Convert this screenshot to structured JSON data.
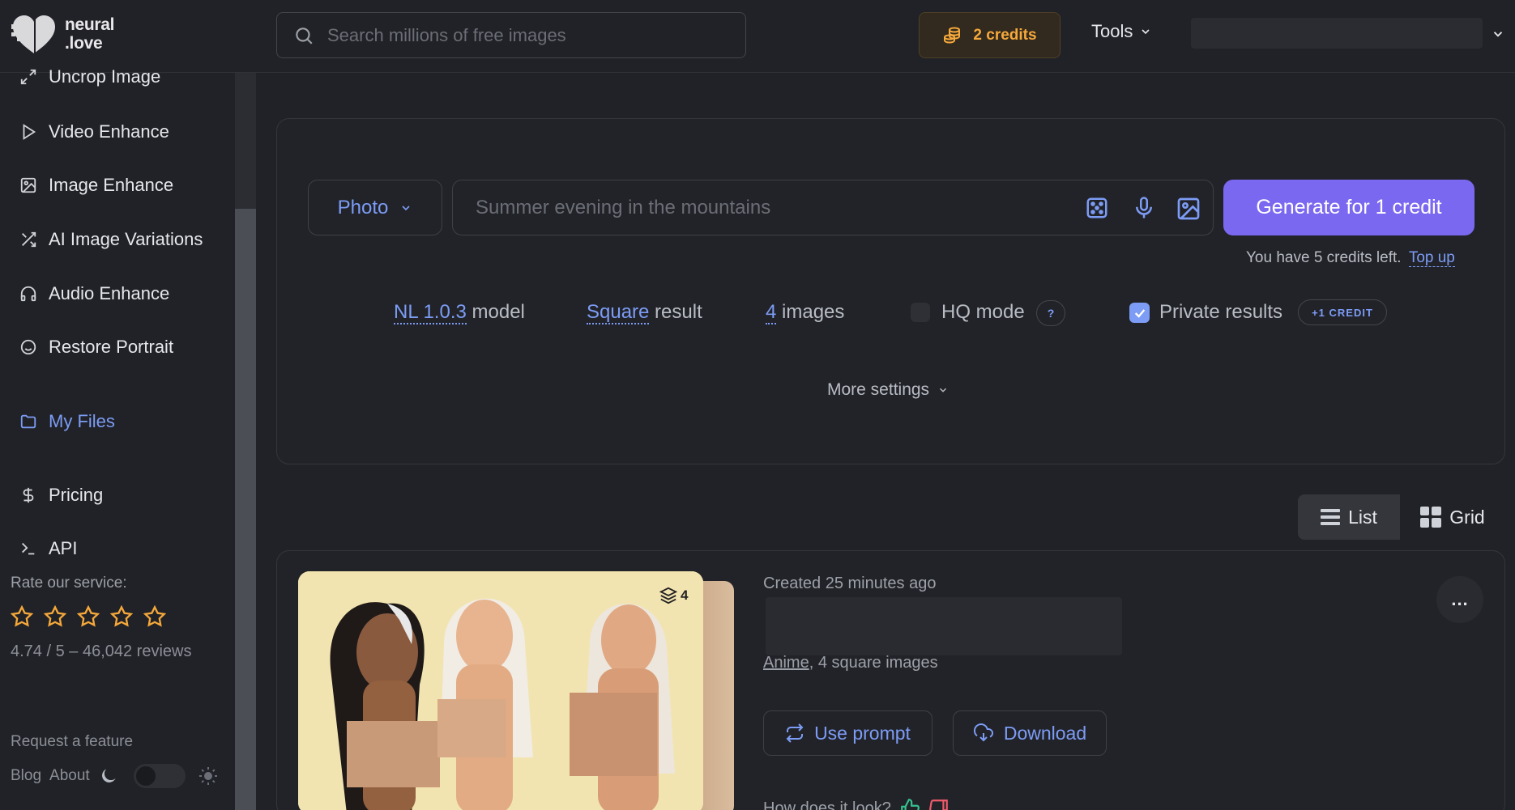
{
  "header": {
    "logo_line1": "neural",
    "logo_line2": ".love",
    "search_placeholder": "Search millions of free images",
    "credits_label": "2 credits",
    "tools_label": "Tools"
  },
  "sidebar": {
    "items": [
      {
        "label": "Uncrop Image",
        "icon": "expand-icon"
      },
      {
        "label": "Video Enhance",
        "icon": "play-icon"
      },
      {
        "label": "Image Enhance",
        "icon": "image-icon"
      },
      {
        "label": "AI Image Variations",
        "icon": "shuffle-icon"
      },
      {
        "label": "Audio Enhance",
        "icon": "headphones-icon"
      },
      {
        "label": "Restore Portrait",
        "icon": "smile-icon"
      }
    ],
    "my_files": "My Files",
    "pricing": "Pricing",
    "api": "API",
    "rate_label": "Rate our service:",
    "rating_text": "4.74 / 5 – 46,042 reviews",
    "request_feature": "Request a feature",
    "blog": "Blog",
    "about": "About"
  },
  "generator": {
    "type_label": "Photo",
    "prompt_placeholder": "Summer evening in the mountains",
    "generate_label": "Generate for 1 credit",
    "credits_left_text": "You have 5 credits left.",
    "top_up": "Top up",
    "model_value": "NL 1.0.3",
    "model_suffix": " model",
    "shape_value": "Square",
    "shape_suffix": " result",
    "count_value": "4",
    "count_suffix": " images",
    "hq_label": "HQ mode",
    "hq_help": "?",
    "hq_checked": false,
    "private_label": "Private results",
    "private_checked": true,
    "credit_badge": "+1 CREDIT",
    "more_settings": "More settings"
  },
  "view_toggle": {
    "list_label": "List",
    "grid_label": "Grid",
    "selected": "List"
  },
  "result": {
    "image_count": "4",
    "created": "Created 25 minutes ago",
    "style_link": "Anime",
    "meta_suffix": ", 4 square images",
    "use_prompt": "Use prompt",
    "download": "Download",
    "feedback_question": "How does it look?",
    "more": "..."
  },
  "colors": {
    "accent": "#7c9cf5",
    "primary_button": "#7b68f0",
    "credits": "#f6a93b",
    "background": "#212227"
  }
}
